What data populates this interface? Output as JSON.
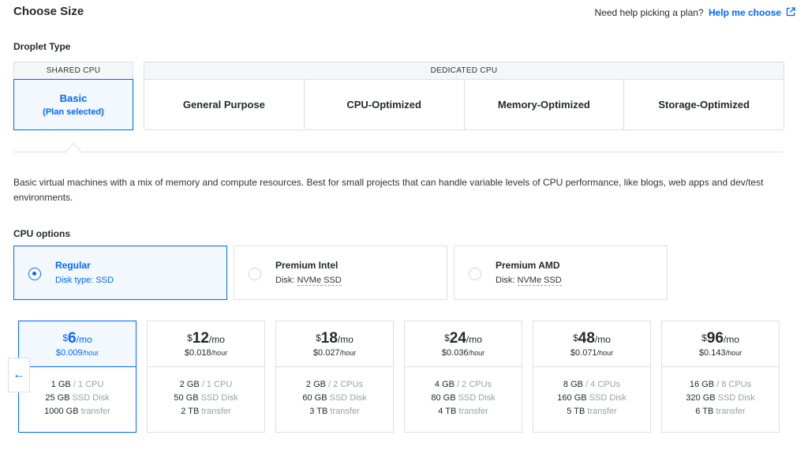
{
  "header": {
    "title": "Choose Size",
    "help_text": "Need help picking a plan?",
    "help_link": "Help me choose"
  },
  "droplet_type": {
    "label": "Droplet Type",
    "shared_header": "SHARED CPU",
    "basic_label": "Basic",
    "basic_sub": "(Plan selected)",
    "dedicated_header": "DEDICATED CPU",
    "dedicated_options": [
      "General Purpose",
      "CPU-Optimized",
      "Memory-Optimized",
      "Storage-Optimized"
    ]
  },
  "description": "Basic virtual machines with a mix of memory and compute resources. Best for small projects that can handle variable levels of CPU performance, like blogs, web apps and dev/test environments.",
  "cpu_options": {
    "label": "CPU options",
    "options": [
      {
        "name": "Regular",
        "disk_prefix": "Disk type: SSD",
        "disk_type": "",
        "selected": true
      },
      {
        "name": "Premium Intel",
        "disk_prefix": "Disk:",
        "disk_type": "NVMe SSD",
        "selected": false
      },
      {
        "name": "Premium AMD",
        "disk_prefix": "Disk:",
        "disk_type": "NVMe SSD",
        "selected": false
      }
    ]
  },
  "plans": [
    {
      "currency": "$",
      "price": "6",
      "per": "/mo",
      "hourly": "$0.009",
      "hour_unit": "/hour",
      "mem": "1 GB",
      "cpu": "/ 1 CPU",
      "disk": "25 GB",
      "disk_unit": "SSD Disk",
      "transfer": "1000 GB",
      "transfer_unit": "transfer",
      "selected": true
    },
    {
      "currency": "$",
      "price": "12",
      "per": "/mo",
      "hourly": "$0.018",
      "hour_unit": "/hour",
      "mem": "2 GB",
      "cpu": "/ 1 CPU",
      "disk": "50 GB",
      "disk_unit": "SSD Disk",
      "transfer": "2 TB",
      "transfer_unit": "transfer",
      "selected": false
    },
    {
      "currency": "$",
      "price": "18",
      "per": "/mo",
      "hourly": "$0.027",
      "hour_unit": "/hour",
      "mem": "2 GB",
      "cpu": "/ 2 CPUs",
      "disk": "60 GB",
      "disk_unit": "SSD Disk",
      "transfer": "3 TB",
      "transfer_unit": "transfer",
      "selected": false
    },
    {
      "currency": "$",
      "price": "24",
      "per": "/mo",
      "hourly": "$0.036",
      "hour_unit": "/hour",
      "mem": "4 GB",
      "cpu": "/ 2 CPUs",
      "disk": "80 GB",
      "disk_unit": "SSD Disk",
      "transfer": "4 TB",
      "transfer_unit": "transfer",
      "selected": false
    },
    {
      "currency": "$",
      "price": "48",
      "per": "/mo",
      "hourly": "$0.071",
      "hour_unit": "/hour",
      "mem": "8 GB",
      "cpu": "/ 4 CPUs",
      "disk": "160 GB",
      "disk_unit": "SSD Disk",
      "transfer": "5 TB",
      "transfer_unit": "transfer",
      "selected": false
    },
    {
      "currency": "$",
      "price": "96",
      "per": "/mo",
      "hourly": "$0.143",
      "hour_unit": "/hour",
      "mem": "16 GB",
      "cpu": "/ 8 CPUs",
      "disk": "320 GB",
      "disk_unit": "SSD Disk",
      "transfer": "6 TB",
      "transfer_unit": "transfer",
      "selected": false
    }
  ],
  "icons": {
    "external_link": "external-link-icon",
    "scroll_left": "arrow-left-icon"
  },
  "colors": {
    "accent": "#0069ff",
    "selected_bg": "#f3f8ff",
    "border": "#dfdfdf"
  }
}
